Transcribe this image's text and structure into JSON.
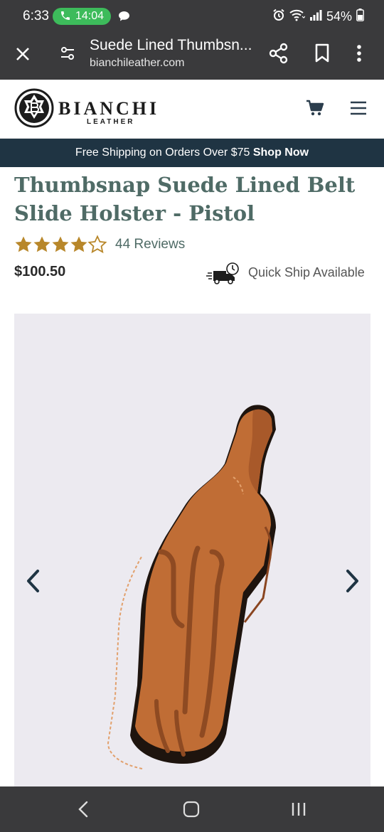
{
  "status_bar": {
    "time": "6:33",
    "call_duration": "14:04",
    "battery": "54%",
    "icons": [
      "phone-icon",
      "chat-bubble-icon",
      "alarm-icon",
      "wifi-icon",
      "signal-icon",
      "battery-icon"
    ]
  },
  "browser": {
    "page_title": "Suede Lined Thumbsn...",
    "domain": "bianchileather.com",
    "icons": [
      "close-icon",
      "site-settings-icon",
      "share-icon",
      "bookmark-icon",
      "more-icon"
    ]
  },
  "site_header": {
    "brand": "BIANCHI",
    "brand_sub": "LEATHER",
    "icons": [
      "logo-mark-icon",
      "cart-icon",
      "menu-icon"
    ]
  },
  "promo": {
    "text": "Free Shipping on Orders Over $75",
    "link": "Shop Now"
  },
  "product": {
    "title": "Thumbsnap Suede Lined Belt Slide Holster - Pistol",
    "rating": 4.5,
    "rating_max": 5,
    "reviews": "44 Reviews",
    "price": "$100.50",
    "quick_ship": "Quick Ship Available"
  },
  "gallery": {
    "image": "holster-photo",
    "icons": [
      "chevron-left-icon",
      "chevron-right-icon"
    ]
  },
  "colors": {
    "dark_bar": "#3a3a3c",
    "promo_bg": "#1f3443",
    "title": "#4f6b66",
    "star": "#b8872a",
    "leather": "#c06d35",
    "call_green": "#3dbb5b"
  },
  "system_nav": {
    "icons": [
      "back-icon",
      "home-icon",
      "recent-apps-icon"
    ]
  }
}
